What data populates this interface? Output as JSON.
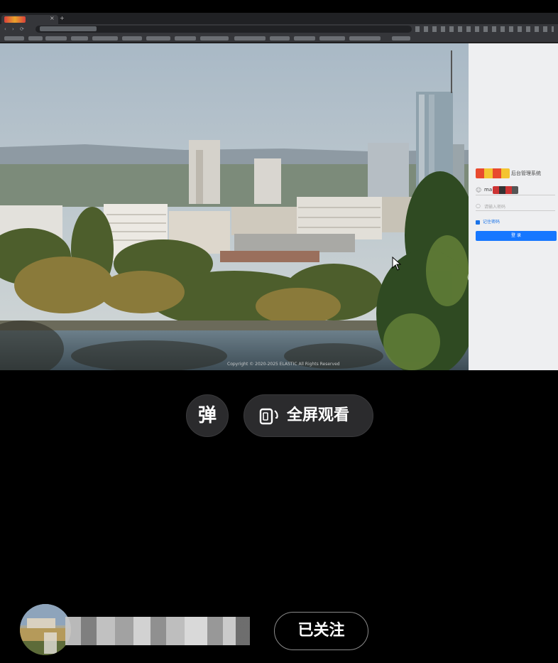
{
  "screen_recording": {
    "login_panel": {
      "logo_text": "后台管理系统",
      "username_value": "ma",
      "password_placeholder": "请输入密码",
      "remember_label": "记住密码",
      "login_button_label": "登 录"
    },
    "copyright": "Copyright © 2020-2025 ELASTIC All Rights Reserved"
  },
  "controls": {
    "danmaku_label": "弹",
    "fullscreen_label": "全屏观看"
  },
  "author": {
    "name": "",
    "follow_label": "已关注"
  },
  "colors": {
    "background": "#000000",
    "pill_button_bg": "#2b2b2d",
    "login_button": "#1677ff"
  }
}
